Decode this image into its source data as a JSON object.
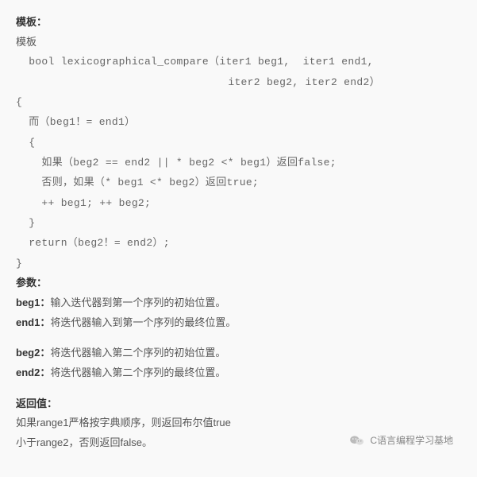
{
  "header": {
    "template_label": "模板：",
    "template_word": "模板"
  },
  "code": {
    "line_sig1": "bool lexicographical_compare（iter1 beg1,  iter1 end1,",
    "line_sig2": "iter2 beg2, iter2 end2）",
    "line_open": "{",
    "line_while": "而（beg1！= end1）",
    "line_open2": "{",
    "line_if": "如果（beg2 == end2 || * beg2 <* beg1）返回false;",
    "line_else": "否则，如果（* beg1 <* beg2）返回true;",
    "line_inc": "++ beg1; ++ beg2;",
    "line_close2": "}",
    "line_return": "return（beg2！= end2）;",
    "line_close": "}"
  },
  "params": {
    "heading": "参数：",
    "beg1_key": "beg1：",
    "beg1_desc": "输入迭代器到第一个序列的初始位置。",
    "end1_key": "end1：",
    "end1_desc": "将迭代器输入到第一个序列的最终位置。",
    "beg2_key": "beg2：",
    "beg2_desc": "将迭代器输入第二个序列的初始位置。",
    "end2_key": "end2：",
    "end2_desc": "将迭代器输入第二个序列的最终位置。"
  },
  "return": {
    "heading": "返回值：",
    "line1": "如果range1严格按字典顺序，则返回布尔值true",
    "line2": "小于range2，否则返回false。"
  },
  "footer": {
    "credit": "C语言编程学习基地"
  }
}
